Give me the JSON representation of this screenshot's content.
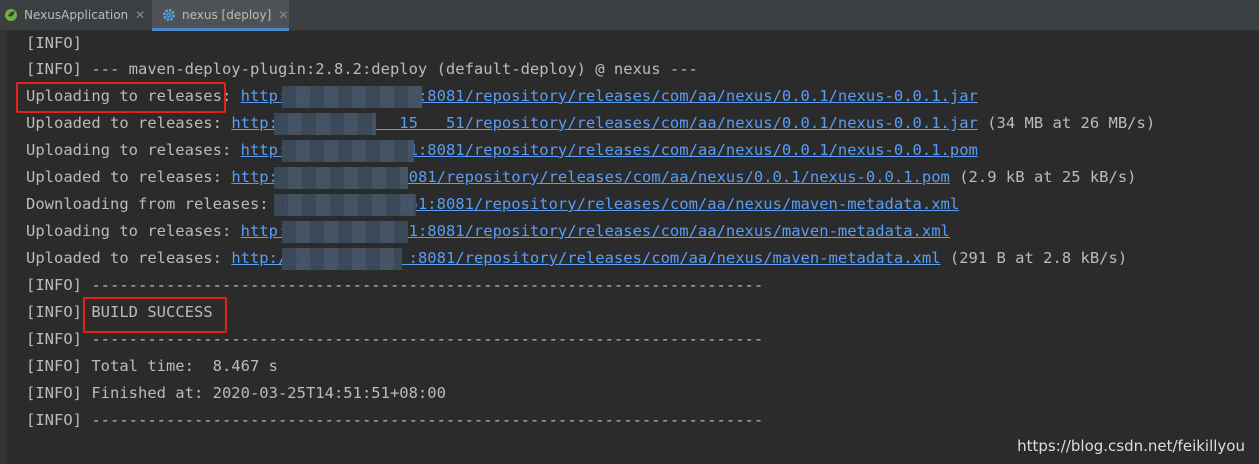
{
  "tabs": [
    {
      "label": "NexusApplication",
      "icon": "spring-app-icon"
    },
    {
      "label": "nexus [deploy]",
      "icon": "gear-icon"
    }
  ],
  "console": {
    "prefix": "[INFO]",
    "line_plugin": "[INFO] --- maven-deploy-plugin:2.8.2:deploy (default-deploy) @ nexus ---",
    "uploading_jar": {
      "label": "Uploading to releases: ",
      "url": "http://            :8081/repository/releases/com/aa/nexus/0.0.1/nexus-0.0.1.jar"
    },
    "uploaded_jar": {
      "label": "Uploaded to releases: ",
      "url": "http://           15   51/repository/releases/com/aa/nexus/0.0.1/nexus-0.0.1.jar",
      "suffix": " (34 MB at 26 MB/s)"
    },
    "uploading_pom": {
      "label": "Uploading to releases: ",
      "url": "http:/            1:8081/repository/releases/com/aa/nexus/0.0.1/nexus-0.0.1.pom"
    },
    "uploaded_pom": {
      "label": "Uploaded to releases: ",
      "url": "http:/            8081/repository/releases/com/aa/nexus/0.0.1/nexus-0.0.1.pom",
      "suffix": " (2.9 kB at 25 kB/s)"
    },
    "downloading_meta": {
      "label": "Downloading from releases: ",
      "url": "h            151:8081/repository/releases/com/aa/nexus/maven-metadata.xml"
    },
    "uploading_meta": {
      "label": "Uploading to releases: ",
      "url": "http:/            1:8081/repository/releases/com/aa/nexus/maven-metadata.xml"
    },
    "uploaded_meta": {
      "label": "Uploaded to releases: ",
      "url": "http://1           :8081/repository/releases/com/aa/nexus/maven-metadata.xml",
      "suffix": " (291 B at 2.8 kB/s)"
    },
    "separator": "[INFO] ------------------------------------------------------------------------",
    "build_success": "BUILD SUCCESS",
    "total_time": "[INFO] Total time:  8.467 s",
    "finished_at": "[INFO] Finished at: 2020-03-25T14:51:51+08:00"
  },
  "watermark": "https://blog.csdn.net/feikillyou",
  "colors": {
    "background": "#2b2b2b",
    "text": "#bbbbbb",
    "link": "#589df6",
    "highlight": "#e2231a",
    "active_tab_underline": "#4a88c7"
  }
}
